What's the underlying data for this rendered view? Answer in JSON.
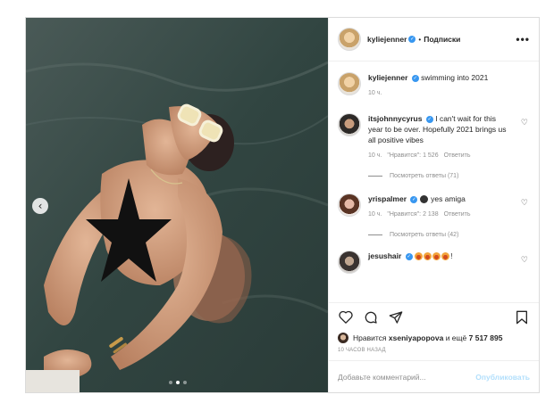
{
  "post": {
    "image_alt": "photo",
    "carousel": {
      "dots": 3,
      "active": 2
    }
  },
  "header": {
    "username": "kyliejenner",
    "separator": "•",
    "follow_label": "Подписки",
    "more_label": "•••"
  },
  "caption": {
    "username": "kyliejenner",
    "text": "swimming into 2021",
    "time": "10 ч."
  },
  "comments": [
    {
      "username": "itsjohnnycyrus",
      "text": "I can't wait for this year to be over. Hopefully 2021 brings us all positive vibes",
      "time": "10 ч.",
      "likes": "\"Нравится\": 1 526",
      "reply_label": "Ответить",
      "replies_label": "Посмотреть ответы (71)"
    },
    {
      "username": "yrispalmer",
      "text": "yes amiga",
      "time": "10 ч.",
      "likes": "\"Нравится\": 2 138",
      "reply_label": "Ответить",
      "replies_label": "Посмотреть ответы (42)"
    },
    {
      "username": "jesushair",
      "text": "!"
    }
  ],
  "likes_line": {
    "prefix": "Нравится",
    "user": "xseniyapopova",
    "middle": "и ещё",
    "count": "7 517 895"
  },
  "time_ago": "10 ЧАСОВ НАЗАД",
  "comment_input": {
    "placeholder": "Добавьте комментарий...",
    "value": ""
  },
  "publish_label": "Опубликовать",
  "icons": {
    "like": "heart-icon",
    "comment": "comment-icon",
    "share": "share-icon",
    "save": "bookmark-icon",
    "prev": "chevron-left-icon"
  },
  "colors": {
    "link_blue": "#3897f0",
    "publish_disabled": "#b2dffc",
    "muted": "#8e8e8e"
  }
}
